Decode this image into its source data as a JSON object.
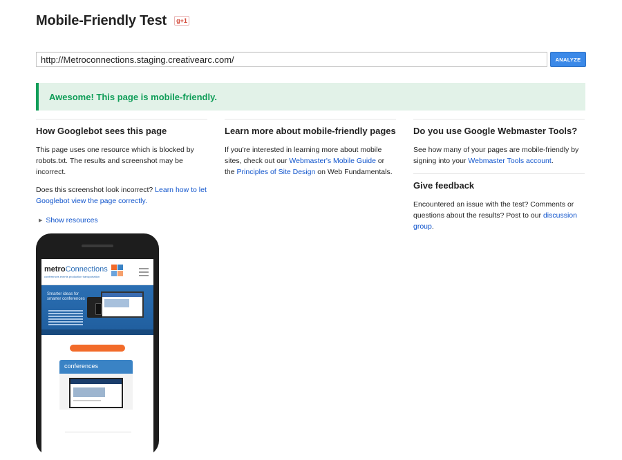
{
  "header": {
    "title": "Mobile-Friendly Test",
    "gplus_label": "g+1"
  },
  "search": {
    "url_value": "http://Metroconnections.staging.creativearc.com/",
    "analyze_label": "ANALYZE"
  },
  "result": {
    "message": "Awesome! This page is mobile-friendly."
  },
  "columns": {
    "googlebot": {
      "heading": "How Googlebot sees this page",
      "p1": "This page uses one resource which is blocked by robots.txt. The results and screenshot may be incorrect.",
      "p2_text": "Does this screenshot look incorrect? ",
      "p2_link": "Learn how to let Googlebot view the page correctly.",
      "show_resources": "Show resources"
    },
    "learn": {
      "heading": "Learn more about mobile-friendly pages",
      "p1_a": "If you're interested in learning more about mobile sites, check out our ",
      "link1": "Webmaster's Mobile Guide",
      "p1_b": " or the ",
      "link2": "Principles of Site Design",
      "p1_c": " on Web Fundamentals."
    },
    "webmaster": {
      "heading": "Do you use Google Webmaster Tools?",
      "p1_a": "See how many of your pages are mobile-friendly by signing into your ",
      "link": "Webmaster Tools account",
      "p1_b": "."
    },
    "feedback": {
      "heading": "Give feedback",
      "p1_a": "Encountered an issue with the test? Comments or questions about the results? Post to our ",
      "link": "discussion group",
      "p1_b": "."
    }
  },
  "preview": {
    "logo_bold": "metro",
    "logo_light": "Connections",
    "logo_sub": "conferences events production transportation",
    "hero_text": "Smarter ideas for smarter conferences",
    "section_tab": "conferences",
    "colors": {
      "orange": "#f26b2a",
      "blue": "#3a83c5",
      "green_accent": "#0f9d58"
    }
  }
}
